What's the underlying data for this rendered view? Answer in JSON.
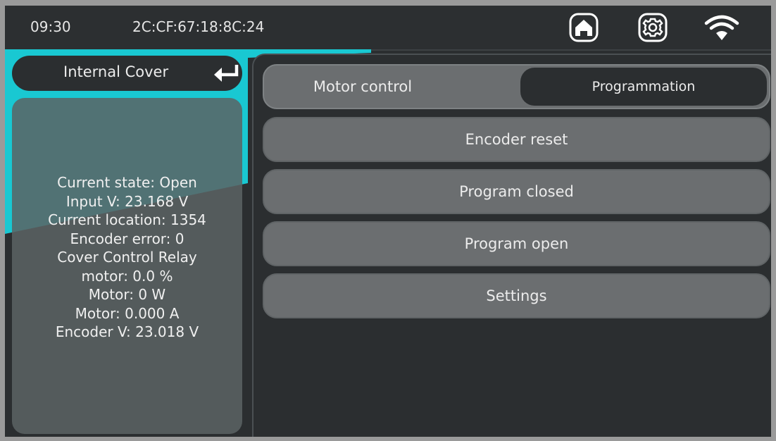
{
  "status_bar": {
    "time": "09:30",
    "mac_address": "2C:CF:67:18:8C:24",
    "icons": [
      "home-icon",
      "gear-icon",
      "wifi-icon"
    ]
  },
  "left": {
    "back_label": "Internal Cover",
    "back_icon": "return-arrow-icon",
    "info_lines": [
      "Current state: Open",
      "Input V: 23.168 V",
      "Current location: 1354",
      "Encoder error: 0",
      "Cover Control Relay",
      "motor: 0.0 %",
      "Motor: 0 W",
      "Motor: 0.000 A",
      "Encoder V: 23.018 V"
    ]
  },
  "tabs": {
    "motor_control": "Motor control",
    "programmation": "Programmation"
  },
  "buttons": {
    "encoder_reset": "Encoder reset",
    "program_closed": "Program closed",
    "program_open": "Program open",
    "settings": "Settings"
  },
  "colors": {
    "accent": "#19c8d2",
    "background": "#2b2e30",
    "button": "#6b6e70"
  }
}
